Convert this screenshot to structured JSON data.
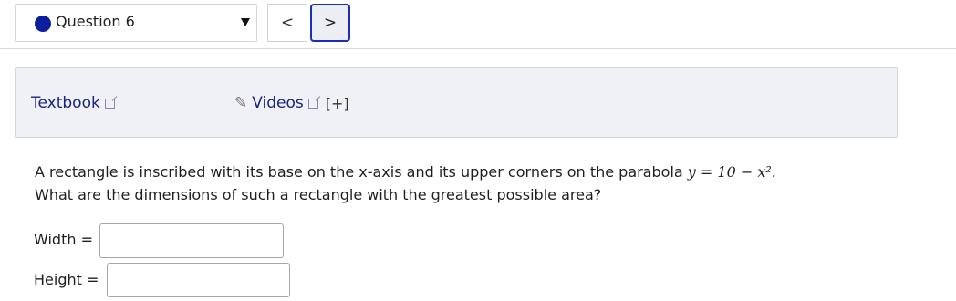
{
  "question_nav": {
    "label": "Question 6",
    "status_color": "#0b1f9c",
    "prev_symbol": "<",
    "next_symbol": ">"
  },
  "resources": {
    "textbook_label": "Textbook",
    "videos_label": "Videos",
    "videos_toggle": "[+]"
  },
  "problem": {
    "line1": "A rectangle is inscribed with its base on the x-axis and its upper corners on the parabola",
    "equation": "y = 10 − x².",
    "line2": "What are the dimensions of such a rectangle with the greatest possible area?"
  },
  "answers": {
    "width_label": "Width =",
    "width_value": "",
    "height_label": "Height =",
    "height_value": ""
  }
}
